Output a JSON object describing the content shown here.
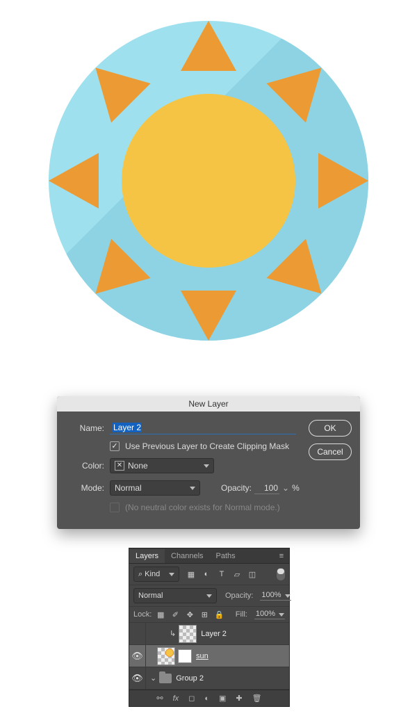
{
  "illustration": {
    "name": "sun-flat-icon",
    "bg_color": "#9ee0ed",
    "shadow_color": "#8dd3e4",
    "ray_color": "#ec9a33",
    "core_color": "#f5c444",
    "ray_count": 8
  },
  "new_layer_dialog": {
    "title": "New Layer",
    "name_label": "Name:",
    "name_value": "Layer 2",
    "clip_checked": true,
    "clip_label": "Use Previous Layer to Create Clipping Mask",
    "color_label": "Color:",
    "color_value": "None",
    "mode_label": "Mode:",
    "mode_value": "Normal",
    "opacity_label": "Opacity:",
    "opacity_value": "100",
    "opacity_suffix": "%",
    "neutral_note": "(No neutral color exists for Normal mode.)",
    "ok": "OK",
    "cancel": "Cancel"
  },
  "layers_panel": {
    "tabs": [
      "Layers",
      "Channels",
      "Paths"
    ],
    "active_tab": 0,
    "kind_filter": "Kind",
    "blend_mode": "Normal",
    "opacity_label": "Opacity:",
    "opacity_value": "100%",
    "lock_label": "Lock:",
    "fill_label": "Fill:",
    "fill_value": "100%",
    "layers": [
      {
        "visible": false,
        "clipped": true,
        "name": "Layer 2",
        "selected": false
      },
      {
        "visible": true,
        "clipped": false,
        "name": "sun",
        "selected": true,
        "smart": true
      },
      {
        "visible": true,
        "group": true,
        "name": "Group 2",
        "selected": false
      }
    ]
  }
}
